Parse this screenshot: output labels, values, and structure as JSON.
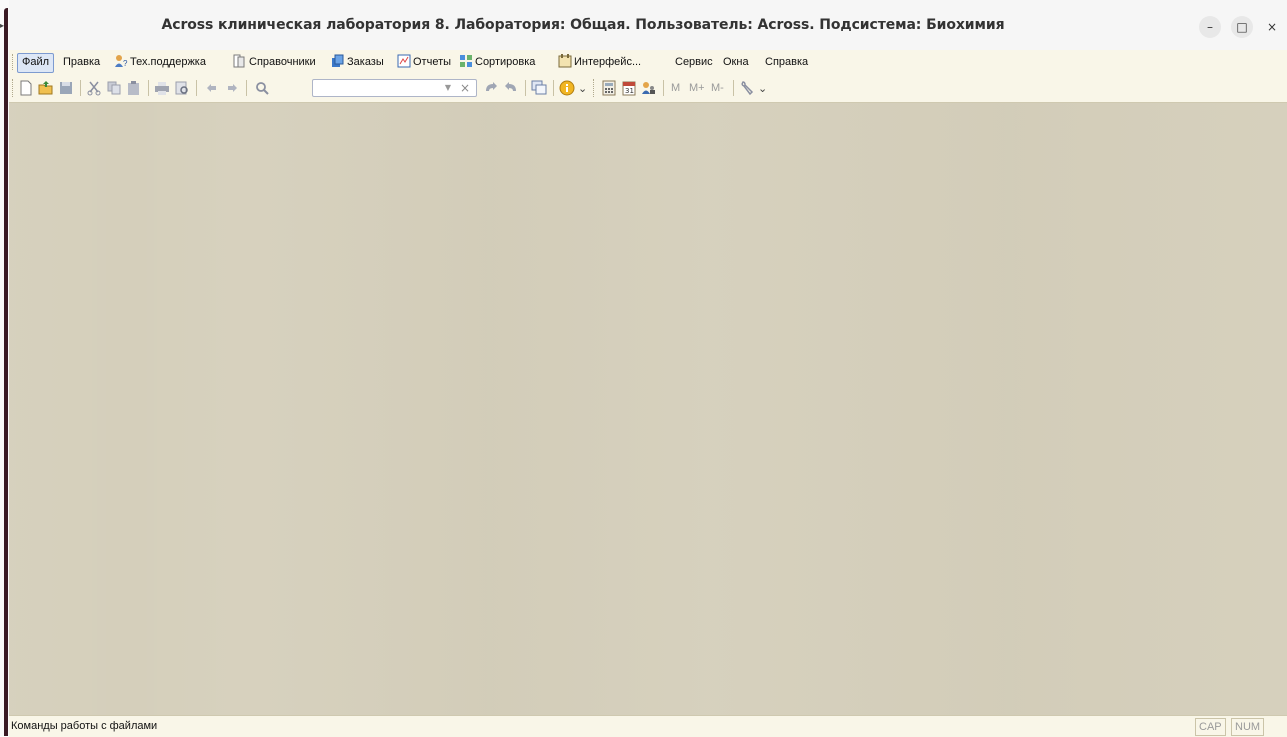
{
  "window": {
    "title": "Across клиническая лаборатория 8.  Лаборатория: Общая.  Пользователь: Across.  Подсистема: Биохимия",
    "controls": {
      "minimize": "–",
      "maximize": "□",
      "close": "×"
    }
  },
  "menubar": {
    "items": [
      {
        "label": "Файл",
        "icon": ""
      },
      {
        "label": "Правка",
        "icon": ""
      },
      {
        "label": "Тех.поддержка",
        "icon": "support-icon"
      },
      {
        "label": "Справочники",
        "icon": "reference-books-icon"
      },
      {
        "label": "Заказы",
        "icon": "orders-icon"
      },
      {
        "label": "Отчеты",
        "icon": "reports-icon"
      },
      {
        "label": "Сортировка",
        "icon": "sorting-icon"
      },
      {
        "label": "Интерфейс...",
        "icon": "interface-icon"
      },
      {
        "label": "Сервис",
        "icon": ""
      },
      {
        "label": "Окна",
        "icon": ""
      },
      {
        "label": "Справка",
        "icon": ""
      }
    ]
  },
  "toolbar": {
    "search": {
      "value": ""
    },
    "m_label": "M",
    "mplus_label": "M+",
    "mminus_label": "M-"
  },
  "statusbar": {
    "text": "Команды работы с файлами",
    "cap": "CAP",
    "num": "NUM"
  },
  "colors": {
    "workspace": "#d5cfbb",
    "bar_background": "#f9f6e8",
    "active_menu": "#dde7f6"
  }
}
